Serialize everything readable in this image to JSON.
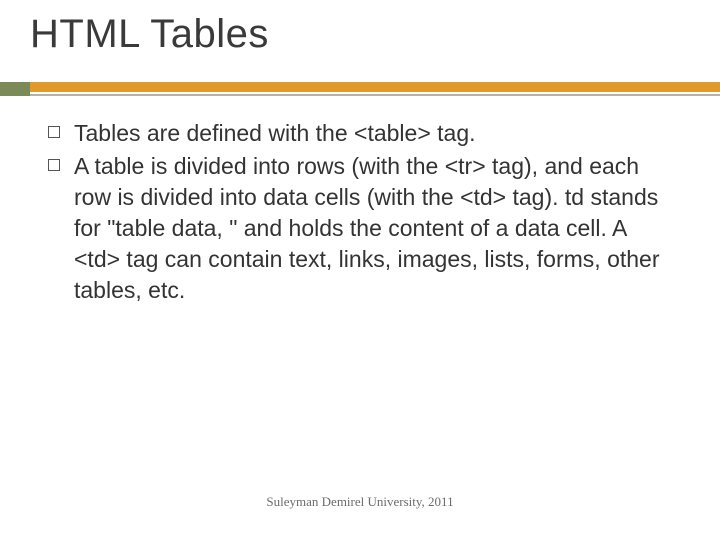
{
  "title": "HTML Tables",
  "bullets": [
    "Tables are defined with the <table> tag.",
    "A table is divided into rows (with the <tr> tag), and each row is divided into data cells (with the <td> tag). td stands for \"table data, \" and holds the content of a data cell. A <td> tag can contain text, links, images, lists, forms, other tables, etc."
  ],
  "footer": "Suleyman Demirel University, 2011",
  "colors": {
    "rule": "#e09a2b",
    "accent": "#7c8a58"
  }
}
